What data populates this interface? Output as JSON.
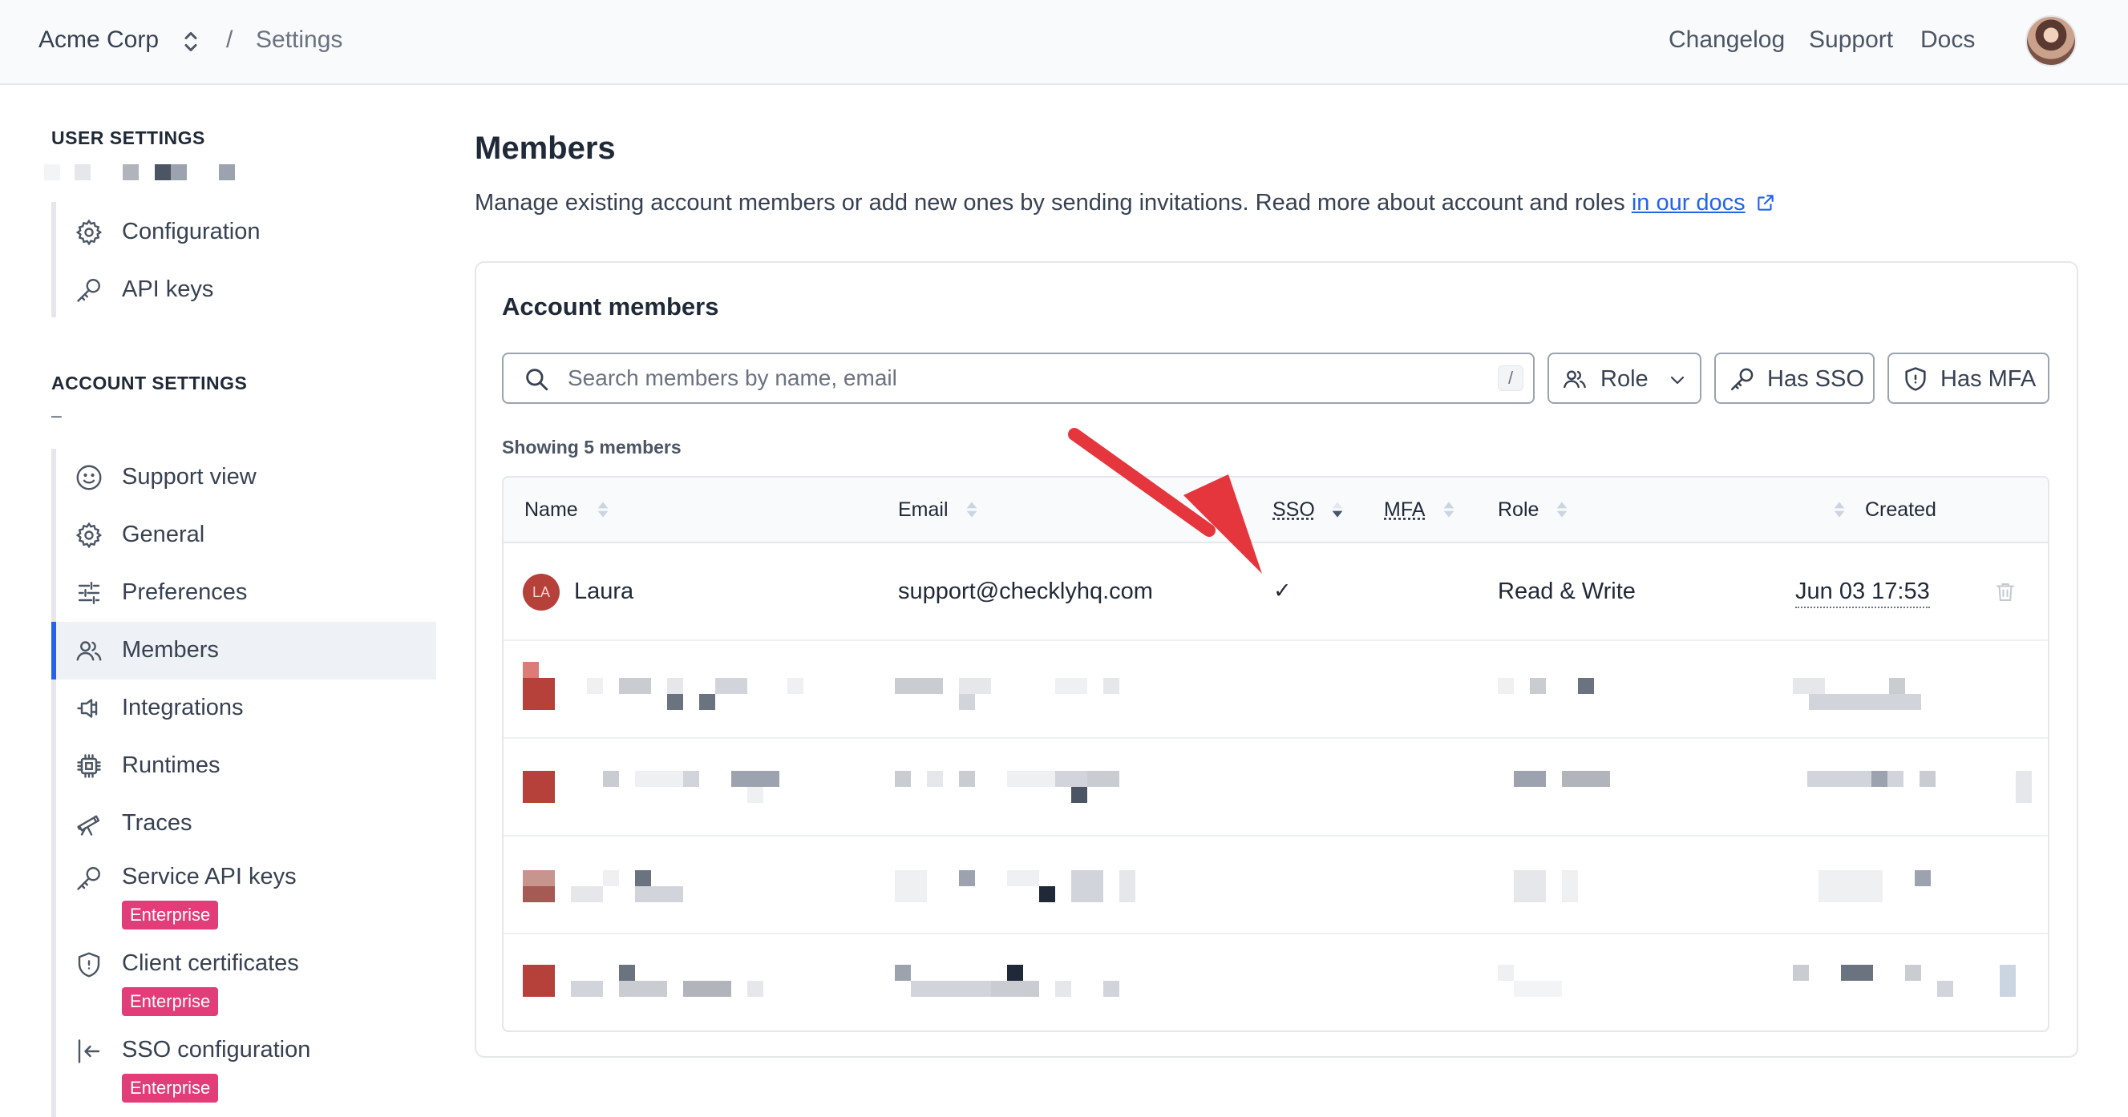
{
  "topbar": {
    "org_name": "Acme Corp",
    "separator": "/",
    "page": "Settings",
    "links": [
      "Changelog",
      "Support",
      "Docs"
    ]
  },
  "sidebar": {
    "user_heading": "USER SETTINGS",
    "user_items": [
      {
        "label": "Configuration",
        "icon": "gear-icon"
      },
      {
        "label": "API keys",
        "icon": "key-icon"
      }
    ],
    "account_heading": "ACCOUNT SETTINGS",
    "account_subtitle": "–",
    "account_items": [
      {
        "label": "Support view",
        "icon": "smiley-icon"
      },
      {
        "label": "General",
        "icon": "gear-icon"
      },
      {
        "label": "Preferences",
        "icon": "sliders-icon"
      },
      {
        "label": "Members",
        "icon": "users-icon",
        "active": true
      },
      {
        "label": "Integrations",
        "icon": "plug-icon"
      },
      {
        "label": "Runtimes",
        "icon": "chip-icon"
      },
      {
        "label": "Traces",
        "icon": "telescope-icon"
      },
      {
        "label": "Service API keys",
        "icon": "key-icon",
        "badge": "Enterprise"
      },
      {
        "label": "Client certificates",
        "icon": "shield-icon",
        "badge": "Enterprise"
      },
      {
        "label": "SSO configuration",
        "icon": "sign-in-icon",
        "badge": "Enterprise"
      }
    ]
  },
  "main": {
    "title": "Members",
    "description": "Manage existing account members or add new ones by sending invitations. Read more about account and roles",
    "docs_link": "in our docs",
    "card_title": "Account members",
    "search_placeholder": "Search members by name, email",
    "search_shortcut": "/",
    "filters": {
      "role": "Role",
      "sso": "Has SSO",
      "mfa": "Has MFA"
    },
    "showing": "Showing 5 members"
  },
  "table": {
    "columns": {
      "name": "Name",
      "email": "Email",
      "sso": "SSO",
      "mfa": "MFA",
      "role": "Role",
      "created": "Created"
    },
    "first_row": {
      "initials": "LA",
      "name": "Laura",
      "email": "support@checklyhq.com",
      "sso": "✓",
      "role": "Read & Write",
      "created": "Jun 03 17:53"
    }
  },
  "colors": {
    "accent": "#2563eb",
    "enterprise_badge": "#e23d78",
    "arrow": "#e5353d",
    "avatar_red": "#b6403a"
  }
}
